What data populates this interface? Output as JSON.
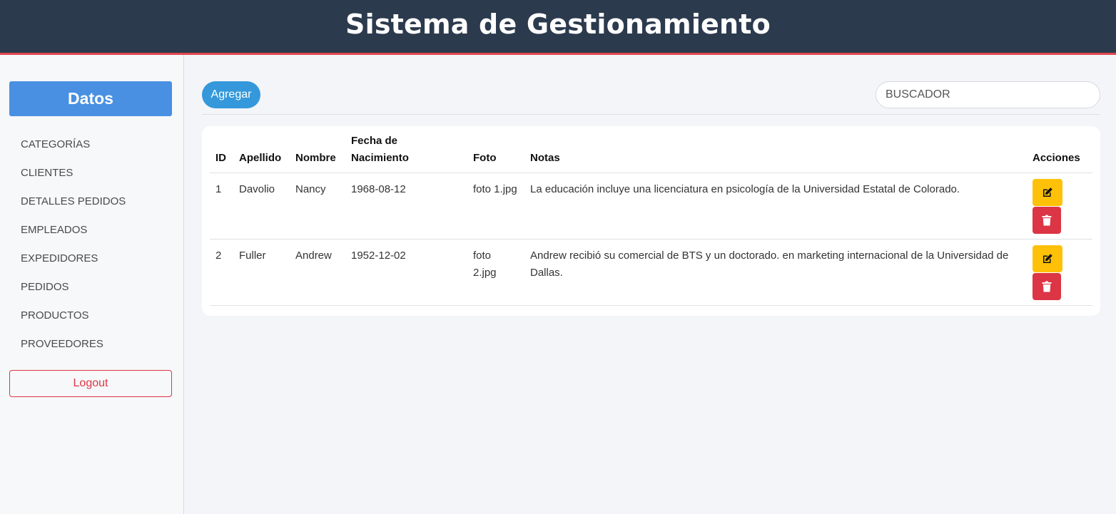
{
  "header": {
    "title": "Sistema de Gestionamiento"
  },
  "sidebar": {
    "title": "Datos",
    "items": [
      {
        "label": "CATEGORÍAS"
      },
      {
        "label": "CLIENTES"
      },
      {
        "label": "DETALLES PEDIDOS"
      },
      {
        "label": "EMPLEADOS"
      },
      {
        "label": "EXPEDIDORES"
      },
      {
        "label": "PEDIDOS"
      },
      {
        "label": "PRODUCTOS"
      },
      {
        "label": "PROVEEDORES"
      }
    ],
    "logout_label": "Logout"
  },
  "toolbar": {
    "add_label": "Agregar",
    "search_placeholder": "BUSCADOR"
  },
  "table": {
    "columns": [
      "ID",
      "Apellido",
      "Nombre",
      "Fecha de Nacimiento",
      "Foto",
      "Notas",
      "Acciones"
    ],
    "rows": [
      {
        "id": "1",
        "apellido": "Davolio",
        "nombre": "Nancy",
        "fecha": "1968-08-12",
        "foto": "foto 1.jpg",
        "notas": "La educación incluye una licenciatura en psicología de la Universidad Estatal de Colorado."
      },
      {
        "id": "2",
        "apellido": "Fuller",
        "nombre": "Andrew",
        "fecha": "1952-12-02",
        "foto": "foto 2.jpg",
        "notas": "Andrew recibió su comercial de BTS y un doctorado. en marketing internacional de la Universidad de Dallas."
      }
    ]
  },
  "icons": {
    "edit": "edit-icon",
    "delete": "trash-icon"
  },
  "colors": {
    "header_bg": "#2c3a4e",
    "header_accent": "#e0474c",
    "primary": "#4a90e2",
    "add_button": "#3498db",
    "edit_button": "#ffc107",
    "delete_button": "#dc3545"
  }
}
